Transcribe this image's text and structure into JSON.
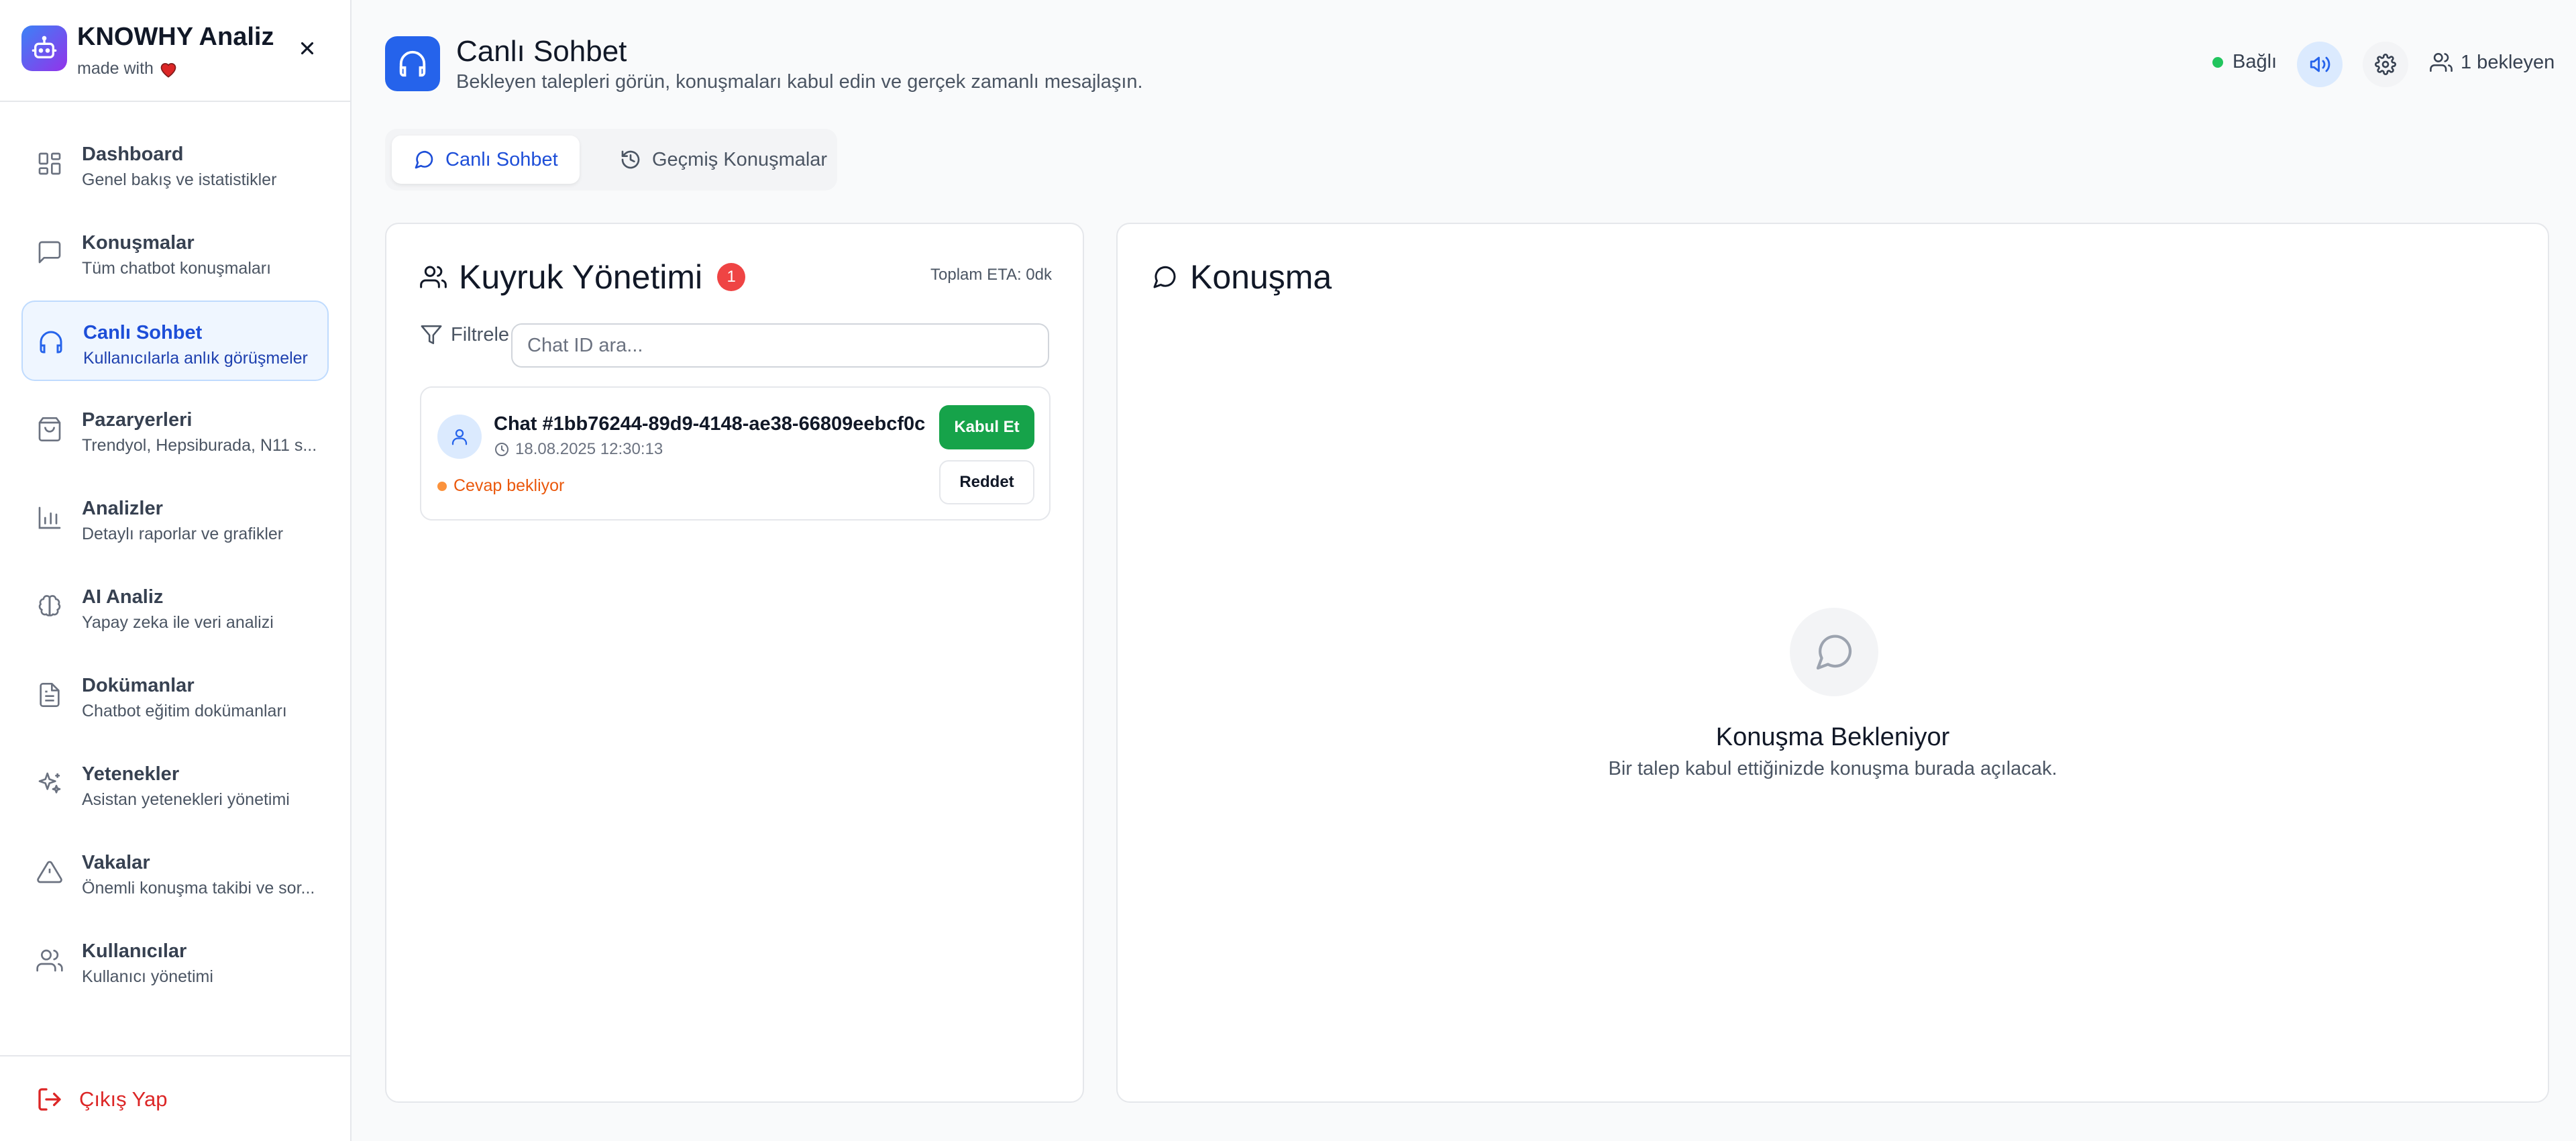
{
  "brand": {
    "title": "KNOWHY Analiz",
    "subtitle": "made with",
    "logo_icon": "bot-icon",
    "heart_color": "#dc2626"
  },
  "sidebar": {
    "items": [
      {
        "title": "Dashboard",
        "desc": "Genel bakış ve istatistikler",
        "icon": "dashboard-icon"
      },
      {
        "title": "Konuşmalar",
        "desc": "Tüm chatbot konuşmaları",
        "icon": "message-square-icon"
      },
      {
        "title": "Canlı Sohbet",
        "desc": "Kullanıcılarla anlık görüşmeler",
        "icon": "headphones-icon",
        "active": true
      },
      {
        "title": "Pazaryerleri",
        "desc": "Trendyol, Hepsiburada, N11 s...",
        "icon": "shopping-bag-icon"
      },
      {
        "title": "Analizler",
        "desc": "Detaylı raporlar ve grafikler",
        "icon": "bar-chart-icon"
      },
      {
        "title": "AI Analiz",
        "desc": "Yapay zeka ile veri analizi",
        "icon": "brain-icon"
      },
      {
        "title": "Dokümanlar",
        "desc": "Chatbot eğitim dokümanları",
        "icon": "file-text-icon"
      },
      {
        "title": "Yetenekler",
        "desc": "Asistan yetenekleri yönetimi",
        "icon": "sparkles-icon"
      },
      {
        "title": "Vakalar",
        "desc": "Önemli konuşma takibi ve sor...",
        "icon": "alert-triangle-icon"
      },
      {
        "title": "Kullanıcılar",
        "desc": "Kullanıcı yönetimi",
        "icon": "users-icon"
      }
    ],
    "logout": "Çıkış Yap"
  },
  "header": {
    "title": "Canlı Sohbet",
    "subtitle": "Bekleyen talepleri görün, konuşmaları kabul edin ve gerçek zamanlı mesajlaşın.",
    "status": "Bağlı",
    "waiting": "1 bekleyen"
  },
  "tabs": [
    {
      "label": "Canlı Sohbet",
      "active": true
    },
    {
      "label": "Geçmiş Konuşmalar",
      "active": false
    }
  ],
  "queue": {
    "title": "Kuyruk Yönetimi",
    "badge": "1",
    "eta": "Toplam ETA: 0dk",
    "filter_label": "Filtrele",
    "search_placeholder": "Chat ID ara...",
    "items": [
      {
        "id": "Chat #1bb76244-89d9-4148-ae38-66809eebcf0c",
        "time": "18.08.2025 12:30:13",
        "status": "Cevap bekliyor",
        "accept": "Kabul Et",
        "reject": "Reddet"
      }
    ]
  },
  "conversation": {
    "title": "Konuşma",
    "empty_title": "Konuşma Bekleniyor",
    "empty_sub": "Bir talep kabul ettiğinizde konuşma burada açılacak."
  },
  "colors": {
    "accent": "#2563eb",
    "success": "#16a34a",
    "danger": "#ef4444",
    "warning": "#ea580c"
  }
}
